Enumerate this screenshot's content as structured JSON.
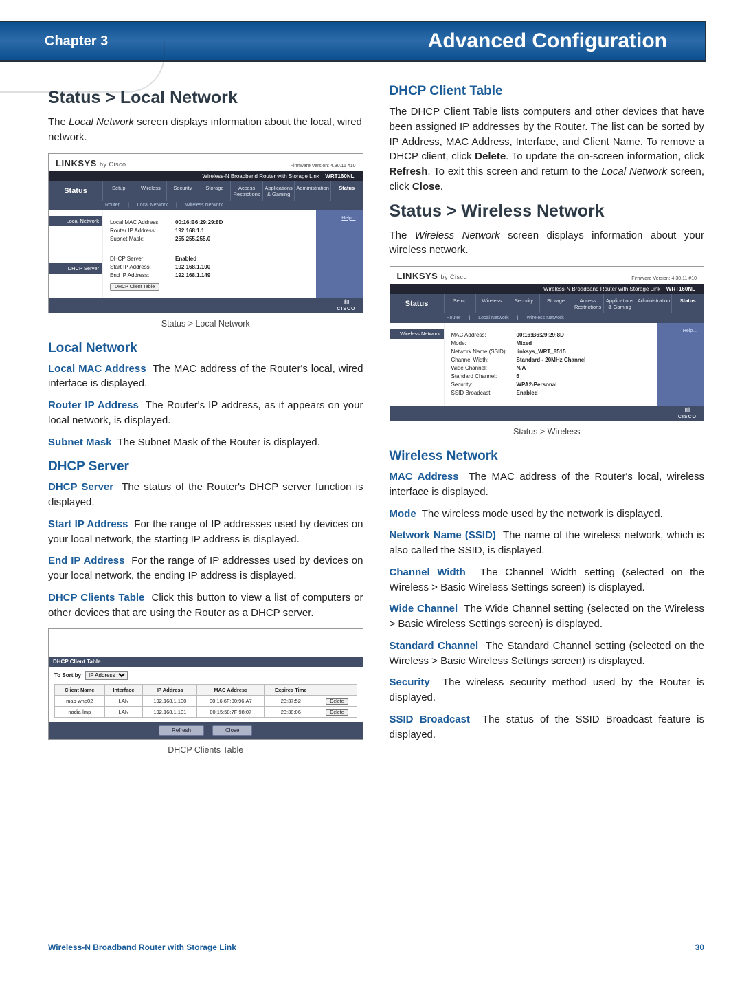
{
  "header": {
    "chapter": "Chapter 3",
    "title": "Advanced Configuration"
  },
  "left": {
    "h_local": "Status > Local Network",
    "intro1": "The ",
    "intro1_ital": "Local Network",
    "intro1_cont": " screen displays information about the local, wired network.",
    "caption1": "Status > Local Network",
    "h_localnet": "Local Network",
    "mac_key": "Local MAC Address",
    "mac_body": "The MAC address of the Router's local, wired interface is displayed.",
    "rip_key": "Router IP Address",
    "rip_body": "The Router's IP address, as it appears on your local network, is displayed.",
    "sub_key": "Subnet Mask",
    "sub_body": "The Subnet Mask of the Router is displayed.",
    "h_dhcp": "DHCP Server",
    "dhs_key": "DHCP Server",
    "dhs_body": "The status of the Router's DHCP server function is displayed.",
    "sip_key": "Start IP Address",
    "sip_body": "For the range of IP addresses used by devices on your local network, the starting IP address is displayed.",
    "eip_key": "End IP Address",
    "eip_body": "For the range of IP addresses used by devices on your local network, the ending IP address is displayed.",
    "dct_key": "DHCP Clients Table",
    "dct_body": "Click this button to view a list of computers or other devices that are using the Router as a DHCP server.",
    "caption2": "DHCP Clients Table"
  },
  "right": {
    "h_clienttable": "DHCP Client Table",
    "ct_body_a": "The DHCP Client Table lists computers and other devices that have been assigned IP addresses by the Router. The list can be sorted by IP Address, MAC Address, Interface, and Client Name. To remove a DHCP client, click ",
    "ct_bold1": "Delete",
    "ct_body_b": ". To update the on-screen information, click ",
    "ct_bold2": "Refresh",
    "ct_body_c": ". To exit this screen and return to the ",
    "ct_ital": "Local Network",
    "ct_body_d": " screen, click ",
    "ct_bold3": "Close",
    "ct_body_e": ".",
    "h_wireless": "Status > Wireless Network",
    "w_intro_a": "The ",
    "w_intro_ital": "Wireless Network",
    "w_intro_b": " screen displays information about your wireless network.",
    "caption3": "Status > Wireless",
    "h_wn": "Wireless Network",
    "wmac_key": "MAC Address",
    "wmac_body": "The MAC address of the Router's local, wireless interface is displayed.",
    "mode_key": "Mode",
    "mode_body": "The wireless mode used by the network is displayed.",
    "ssid_key": "Network Name (SSID)",
    "ssid_body": "The name of the wireless network, which is also called the SSID, is displayed.",
    "cw_key": "Channel Width",
    "cw_body_a": "The Channel Width setting (selected on the ",
    "cw_ital": "Wireless > Basic Wireless Settings",
    "cw_body_b": " screen) is displayed.",
    "wc_key": "Wide Channel",
    "wc_body_a": "The Wide Channel setting (selected on the ",
    "wc_ital": "Wireless > Basic Wireless Settings",
    "wc_body_b": " screen) is displayed.",
    "sc_key": "Standard Channel",
    "sc_body_a": "The Standard Channel setting (selected on the ",
    "sc_ital": "Wireless > Basic Wireless Settings",
    "sc_body_b": " screen) is displayed.",
    "sec_key": "Security",
    "sec_body": "The wireless security method used by the Router is displayed.",
    "sb_key": "SSID Broadcast",
    "sb_body": "The status of the SSID Broadcast feature is displayed."
  },
  "router_tabs": [
    "Setup",
    "Wireless",
    "Security",
    "Storage",
    "Access Restrictions",
    "Applications & Gaming",
    "Administration",
    "Status"
  ],
  "router1": {
    "logo": "LINKSYS",
    "logo_sub": "by Cisco",
    "fw": "Firmware Version: 4.30.11 #10",
    "bar": "Wireless-N Broadband Router with Storage Link",
    "model": "WRT160NL",
    "status": "Status",
    "sub1": "Router",
    "sub2": "Local Network",
    "sub3": "Wireless Network",
    "side1": "Local Network",
    "side2": "DHCP Server",
    "help": "Help...",
    "r1l": "Local MAC Address:",
    "r1v": "00:16:B6:29:29:8D",
    "r2l": "Router IP Address:",
    "r2v": "192.168.1.1",
    "r3l": "Subnet Mask:",
    "r3v": "255.255.255.0",
    "r4l": "DHCP Server:",
    "r4v": "Enabled",
    "r5l": "Start IP Address:",
    "r5v": "192.168.1.100",
    "r6l": "End IP Address:",
    "r6v": "192.168.1.149",
    "btn": "DHCP Client Table"
  },
  "dhcp": {
    "title": "DHCP Client Table",
    "sortlabel": "To Sort by",
    "sortopt": "IP Address",
    "cols": [
      "Client Name",
      "Interface",
      "IP Address",
      "MAC Address",
      "Expires Time",
      ""
    ],
    "rows": [
      [
        "map-wnp02",
        "LAN",
        "192.168.1.100",
        "00:16:6F:00:96:A7",
        "23:37:52"
      ],
      [
        "nadia-lmp",
        "LAN",
        "192.168.1.101",
        "00:15:58:7F:98:07",
        "23:38:06"
      ]
    ],
    "del": "Delete",
    "refresh": "Refresh",
    "close": "Close"
  },
  "router2": {
    "side": "Wireless Network",
    "r1l": "MAC Address:",
    "r1v": "00:16:B6:29:29:8D",
    "r2l": "Mode:",
    "r2v": "Mixed",
    "r3l": "Network Name (SSID):",
    "r3v": "linksys_WRT_8515",
    "r4l": "Channel Width:",
    "r4v": "Standard - 20MHz Channel",
    "r5l": "Wide Channel:",
    "r5v": "N/A",
    "r6l": "Standard Channel:",
    "r6v": "6",
    "r7l": "Security:",
    "r7v": "WPA2-Personal",
    "r8l": "SSID Broadcast:",
    "r8v": "Enabled"
  },
  "footer": {
    "product": "Wireless-N Broadband Router with Storage Link",
    "page": "30"
  }
}
